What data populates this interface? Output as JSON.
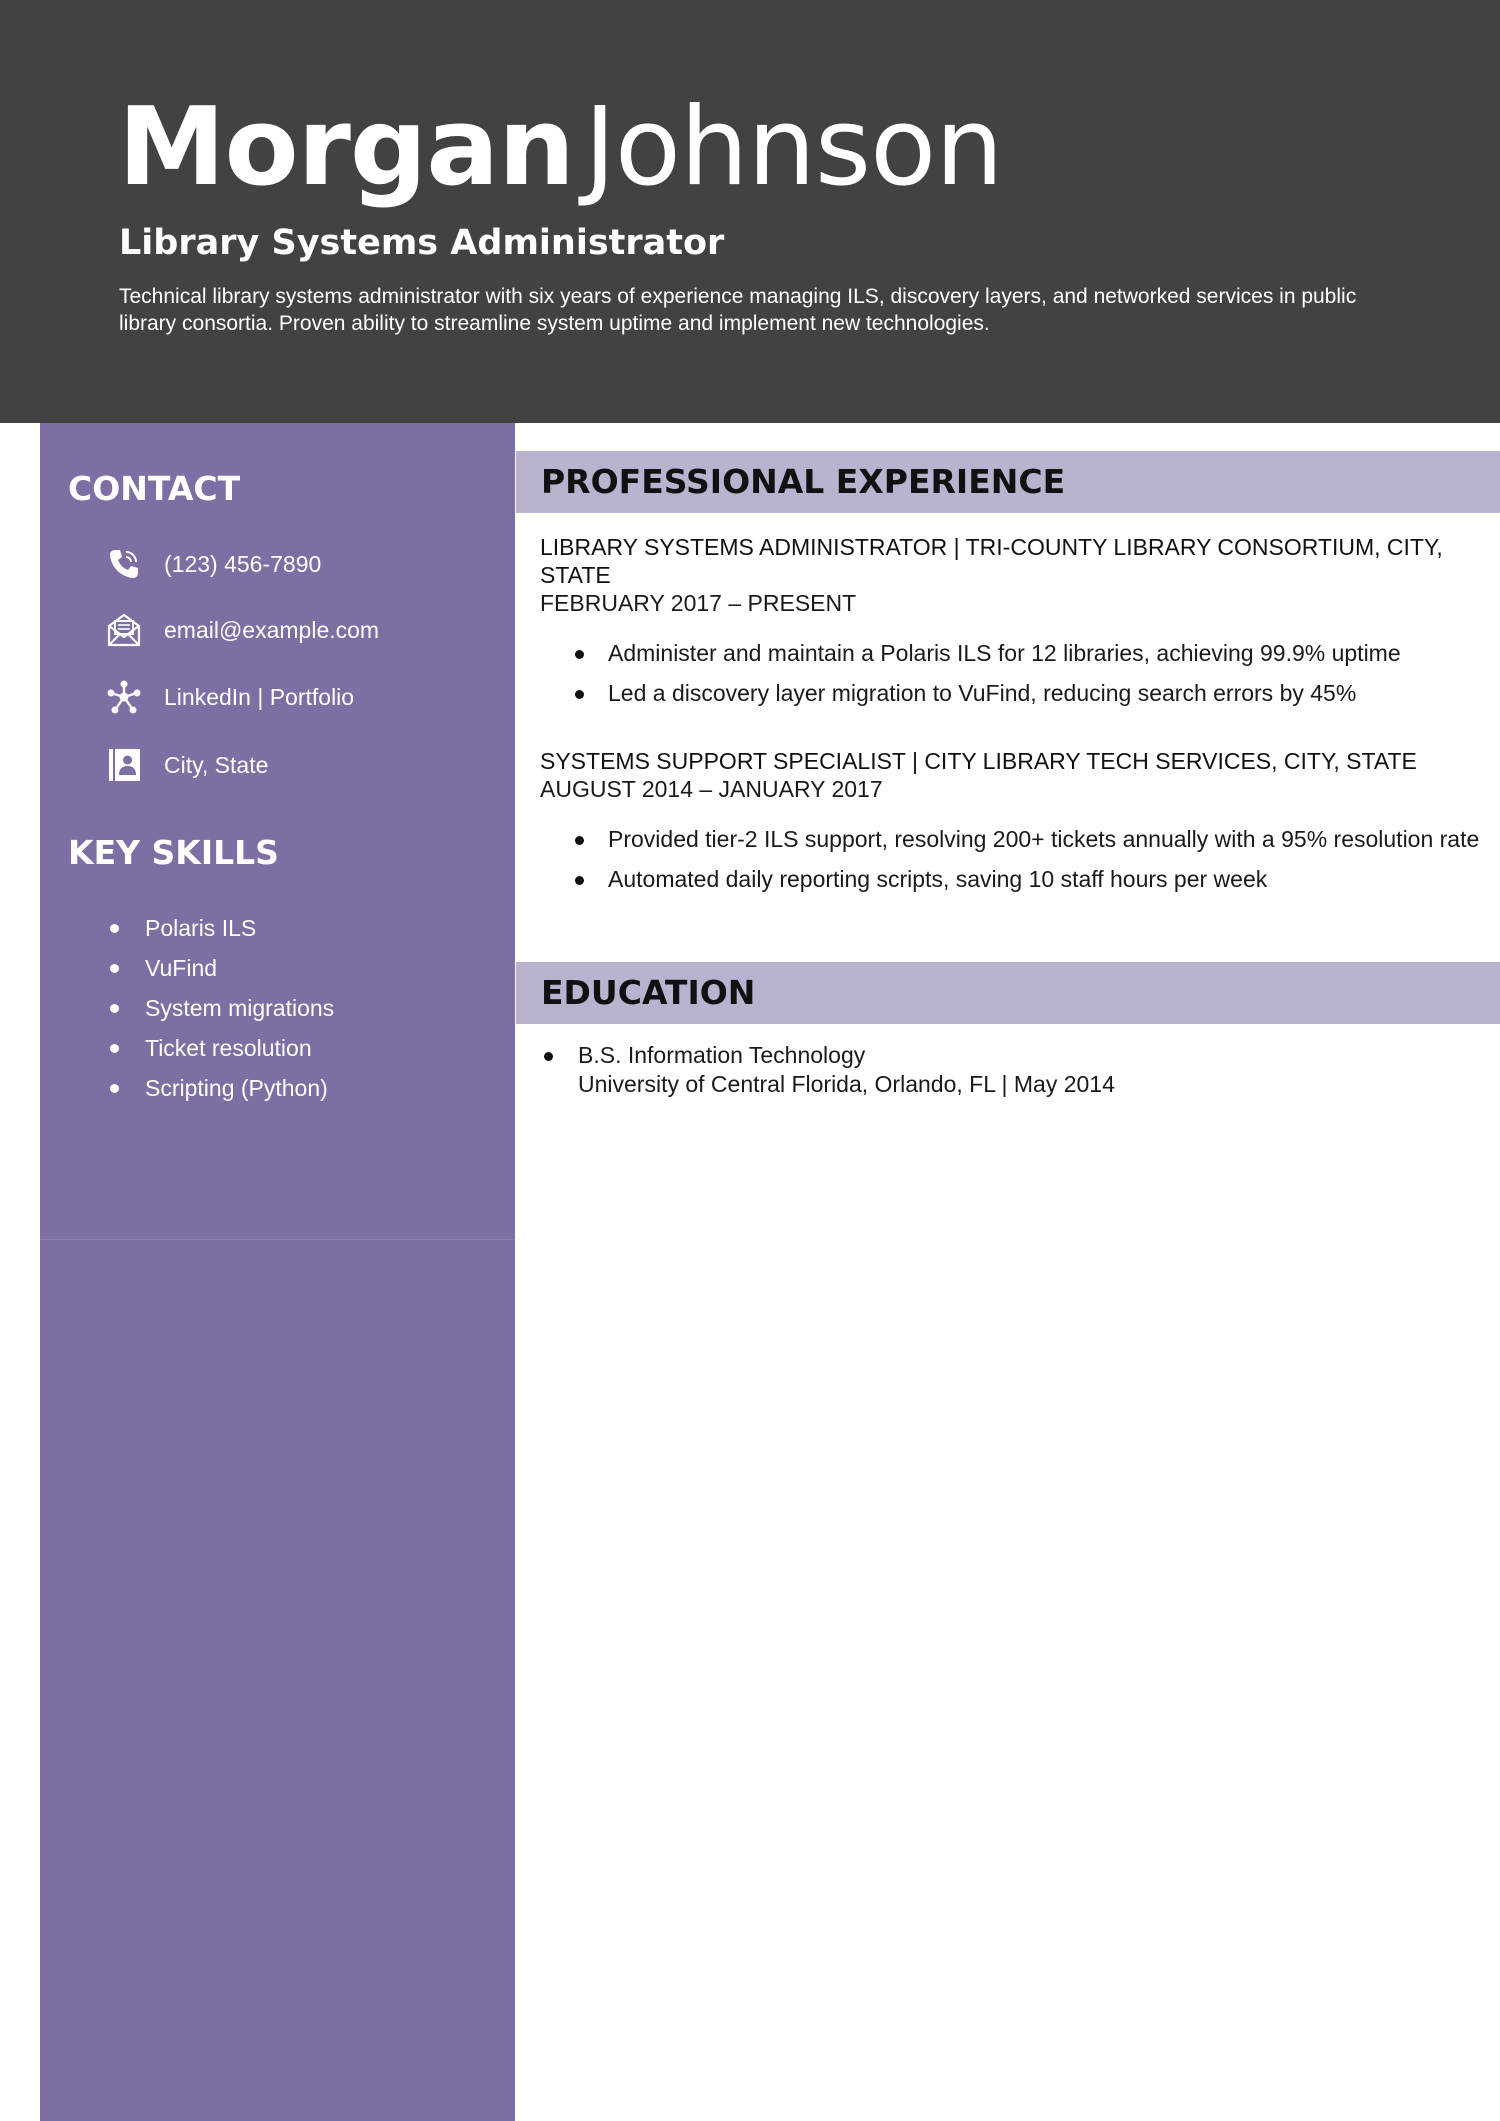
{
  "header": {
    "first_name": "Morgan",
    "last_name": "Johnson",
    "job_title": "Library Systems Administrator",
    "summary": "Technical library systems administrator with six years of experience managing ILS, discovery layers, and networked services in public library consortia. Proven ability to streamline system uptime and implement new technologies."
  },
  "sidebar": {
    "contact_heading": "CONTACT",
    "contact": [
      {
        "icon": "phone-icon",
        "text": "(123) 456-7890"
      },
      {
        "icon": "email-icon",
        "text": "email@example.com"
      },
      {
        "icon": "network-icon",
        "text": "LinkedIn | Portfolio"
      },
      {
        "icon": "address-book-icon",
        "text": "City, State"
      }
    ],
    "skills_heading": "KEY SKILLS",
    "skills": [
      "Polaris ILS",
      "VuFind",
      "System migrations",
      "Ticket resolution",
      "Scripting (Python)"
    ]
  },
  "experience": {
    "heading": "PROFESSIONAL EXPERIENCE",
    "jobs": [
      {
        "title_line": "LIBRARY SYSTEMS ADMINISTRATOR | TRI-COUNTY LIBRARY CONSORTIUM, CITY, STATE",
        "dates": "FEBRUARY 2017 – PRESENT",
        "bullets": [
          "Administer and maintain a Polaris ILS for 12 libraries, achieving 99.9% uptime",
          "Led a discovery layer migration to VuFind, reducing search errors by 45%"
        ]
      },
      {
        "title_line": "SYSTEMS SUPPORT SPECIALIST | CITY LIBRARY TECH SERVICES, CITY, STATE",
        "dates": "AUGUST 2014 – JANUARY 2017",
        "bullets": [
          "Provided tier-2 ILS support, resolving 200+ tickets annually with a 95% resolution rate",
          "Automated daily reporting scripts, saving 10 staff hours per week"
        ]
      }
    ]
  },
  "education": {
    "heading": "EDUCATION",
    "entries": [
      {
        "degree": "B.S. Information Technology",
        "school": "University of Central Florida, Orlando, FL | May 2014"
      }
    ]
  },
  "colors": {
    "header_bg": "#424242",
    "sidebar_bg": "#7d6ea3",
    "section_band": "#b9b3d0"
  }
}
